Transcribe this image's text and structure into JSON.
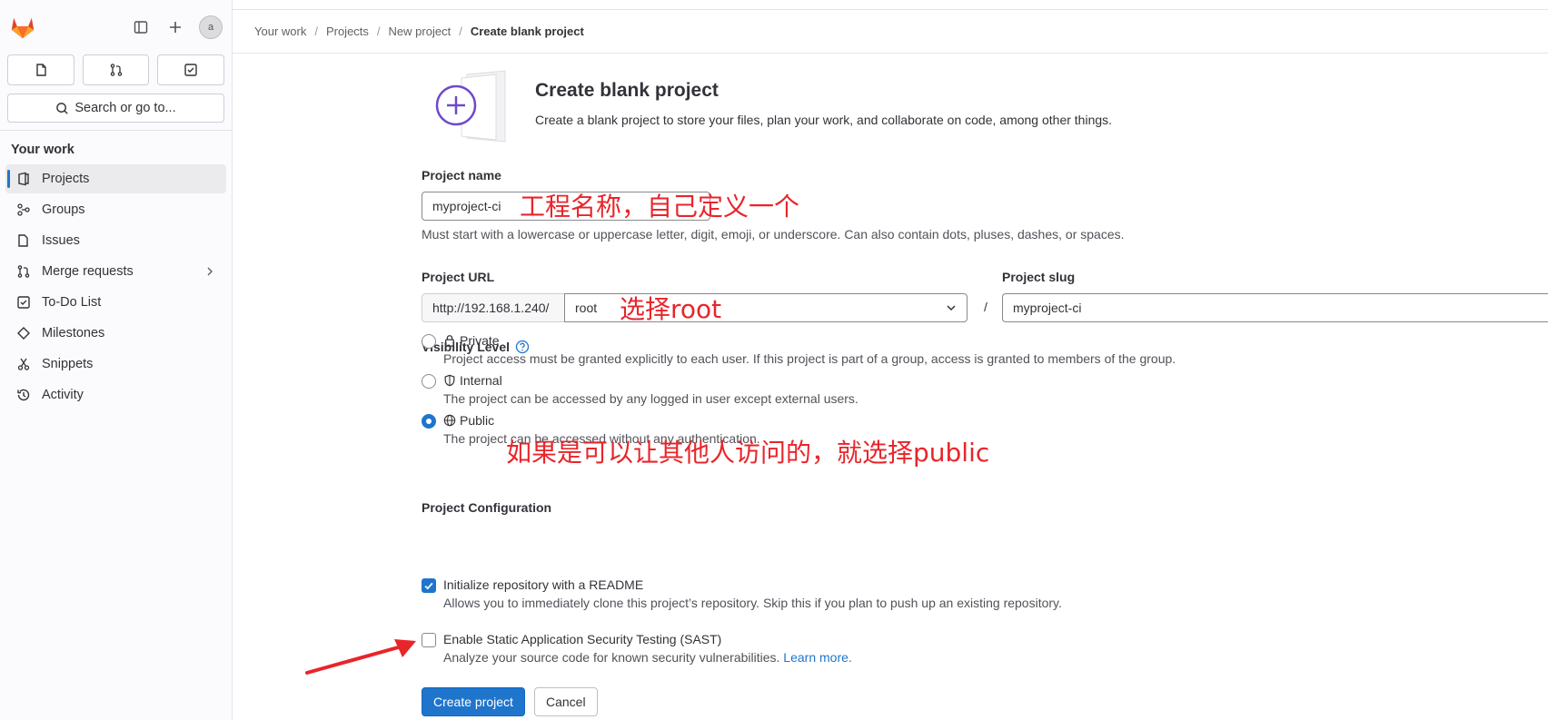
{
  "sidebar": {
    "search_label": "Search or go to...",
    "section_title": "Your work",
    "items": [
      {
        "label": "Projects"
      },
      {
        "label": "Groups"
      },
      {
        "label": "Issues"
      },
      {
        "label": "Merge requests"
      },
      {
        "label": "To-Do List"
      },
      {
        "label": "Milestones"
      },
      {
        "label": "Snippets"
      },
      {
        "label": "Activity"
      }
    ],
    "avatar_alt": "a"
  },
  "breadcrumbs": [
    "Your work",
    "Projects",
    "New project",
    "Create blank project"
  ],
  "header": {
    "title": "Create blank project",
    "subtitle": "Create a blank project to store your files, plan your work, and collaborate on code, among other things."
  },
  "form": {
    "project_name_label": "Project name",
    "project_name_value": "myproject-ci",
    "project_name_help": "Must start with a lowercase or uppercase letter, digit, emoji, or underscore. Can also contain dots, pluses, dashes, or spaces.",
    "project_url_label": "Project URL",
    "url_prefix": "http://192.168.1.240/",
    "namespace_value": "root",
    "slash": "/",
    "project_slug_label": "Project slug",
    "project_slug_value": "myproject-ci",
    "visibility_label": "Visibility Level",
    "visibility": [
      {
        "label": "Private",
        "description": "Project access must be granted explicitly to each user. If this project is part of a group, access is granted to members of the group.",
        "selected": false
      },
      {
        "label": "Internal",
        "description": "The project can be accessed by any logged in user except external users.",
        "selected": false
      },
      {
        "label": "Public",
        "description": "The project can be accessed without any authentication.",
        "selected": true
      }
    ],
    "config_label": "Project Configuration",
    "readme": {
      "label": "Initialize repository with a README",
      "description": "Allows you to immediately clone this project’s repository. Skip this if you plan to push up an existing repository.",
      "checked": true
    },
    "sast": {
      "label": "Enable Static Application Security Testing (SAST)",
      "description": "Analyze your source code for known security vulnerabilities.",
      "link": "Learn more.",
      "checked": false
    },
    "create_button": "Create project",
    "cancel_button": "Cancel"
  },
  "annotations": {
    "name_note": "工程名称，自己定义一个",
    "namespace_note": "选择root",
    "public_note": "如果是可以让其他人访问的，就选择public"
  },
  "colors": {
    "accent": "#1f75cb",
    "annotation": "#e8252b",
    "logo": "#e24329"
  }
}
